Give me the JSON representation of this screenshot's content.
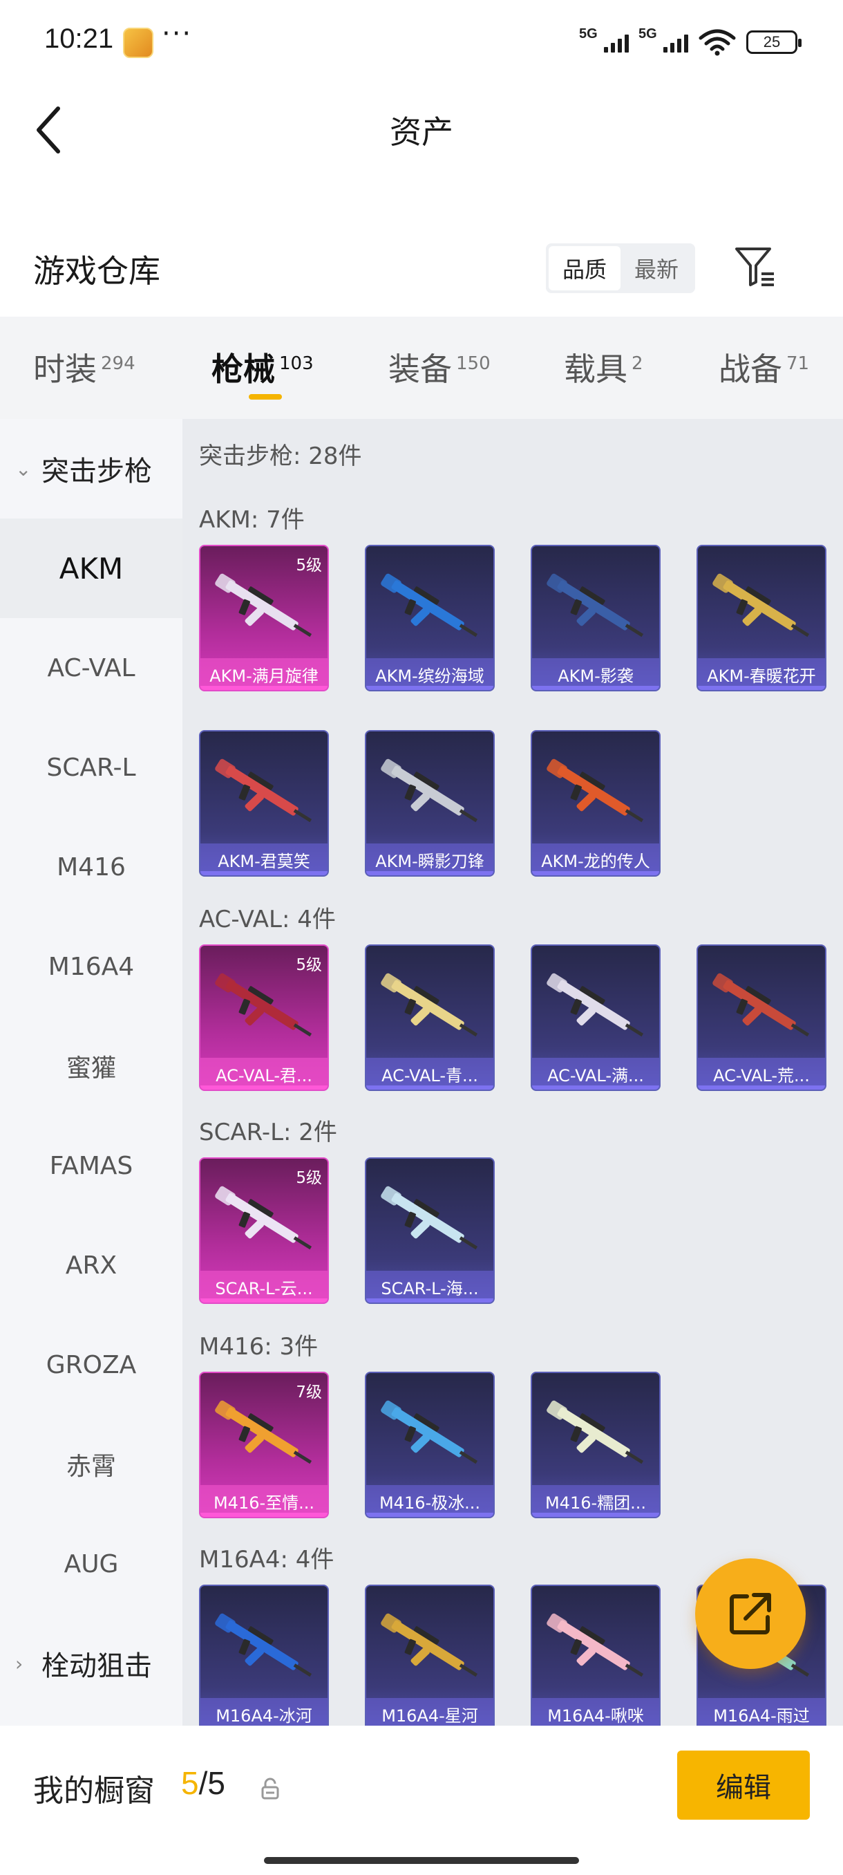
{
  "status": {
    "time": "10:21",
    "dots": "···",
    "signal1": "5G",
    "signal2": "5G",
    "battery": "25"
  },
  "header": {
    "title": "资产"
  },
  "warehouse": {
    "title": "游戏仓库",
    "sort_quality": "品质",
    "sort_newest": "最新"
  },
  "tabs": [
    {
      "label": "时装",
      "count": "294"
    },
    {
      "label": "枪械",
      "count": "103"
    },
    {
      "label": "装备",
      "count": "150"
    },
    {
      "label": "载具",
      "count": "2"
    },
    {
      "label": "战备",
      "count": "71"
    }
  ],
  "sidebar": {
    "group_open": "突击步枪",
    "items": [
      "AKM",
      "AC-VAL",
      "SCAR-L",
      "M416",
      "M16A4",
      "蜜獾",
      "FAMAS",
      "ARX",
      "GROZA",
      "赤霄",
      "AUG"
    ],
    "group_closed": "栓动狙击"
  },
  "content": {
    "summary": "突击步枪: 28件",
    "categories": [
      {
        "title": "AKM: 7件",
        "cards": [
          {
            "name": "AKM-满月旋律",
            "level": "5级",
            "rarity": "gold",
            "color": "#e8e0f0"
          },
          {
            "name": "AKM-缤纷海域",
            "level": "",
            "rarity": "purple",
            "color": "#2a78d8"
          },
          {
            "name": "AKM-影袭",
            "level": "",
            "rarity": "purple",
            "color": "#3a5fa8"
          },
          {
            "name": "AKM-春暖花开",
            "level": "",
            "rarity": "purple",
            "color": "#d8b24a"
          },
          {
            "name": "AKM-君莫笑",
            "level": "",
            "rarity": "purple",
            "color": "#d84a4a"
          },
          {
            "name": "AKM-瞬影刀锋",
            "level": "",
            "rarity": "purple",
            "color": "#c8ccd4"
          },
          {
            "name": "AKM-龙的传人",
            "level": "",
            "rarity": "purple",
            "color": "#e05a2a"
          }
        ]
      },
      {
        "title": "AC-VAL: 4件",
        "cards": [
          {
            "name": "AC-VAL-君...",
            "level": "5级",
            "rarity": "gold",
            "color": "#b02a3a"
          },
          {
            "name": "AC-VAL-青...",
            "level": "",
            "rarity": "purple",
            "color": "#e8d48a"
          },
          {
            "name": "AC-VAL-满...",
            "level": "",
            "rarity": "purple",
            "color": "#e0dcea"
          },
          {
            "name": "AC-VAL-荒...",
            "level": "",
            "rarity": "purple",
            "color": "#c84a3a"
          }
        ]
      },
      {
        "title": "SCAR-L: 2件",
        "cards": [
          {
            "name": "SCAR-L-云...",
            "level": "5级",
            "rarity": "gold",
            "color": "#ece4f4"
          },
          {
            "name": "SCAR-L-海...",
            "level": "",
            "rarity": "purple",
            "color": "#c8e4f0"
          }
        ]
      },
      {
        "title": "M416: 3件",
        "cards": [
          {
            "name": "M416-至情...",
            "level": "7级",
            "rarity": "gold",
            "color": "#f0a030"
          },
          {
            "name": "M416-极冰...",
            "level": "",
            "rarity": "purple",
            "color": "#4aa8e8"
          },
          {
            "name": "M416-糯团...",
            "level": "",
            "rarity": "purple",
            "color": "#e8ecd0"
          }
        ]
      },
      {
        "title": "M16A4: 4件",
        "cards": [
          {
            "name": "M16A4-冰河",
            "level": "",
            "rarity": "purple",
            "color": "#2a6ad8"
          },
          {
            "name": "M16A4-星河",
            "level": "",
            "rarity": "purple",
            "color": "#d8a83a"
          },
          {
            "name": "M16A4-啾咪",
            "level": "",
            "rarity": "purple",
            "color": "#f4b8c8"
          },
          {
            "name": "M16A4-雨过",
            "level": "",
            "rarity": "purple",
            "color": "#8ad8c8"
          }
        ]
      }
    ]
  },
  "bottom": {
    "label": "我的橱窗",
    "current": "5",
    "total": "/5",
    "edit": "编辑"
  },
  "colors": {
    "accent": "#f5b400",
    "gold_card": "#d63bbd",
    "purple_card": "#3b3a78"
  },
  "icons": {
    "back": "chevron-left-icon",
    "filter": "filter-icon",
    "share": "share-external-icon",
    "lock": "lock-icon"
  }
}
